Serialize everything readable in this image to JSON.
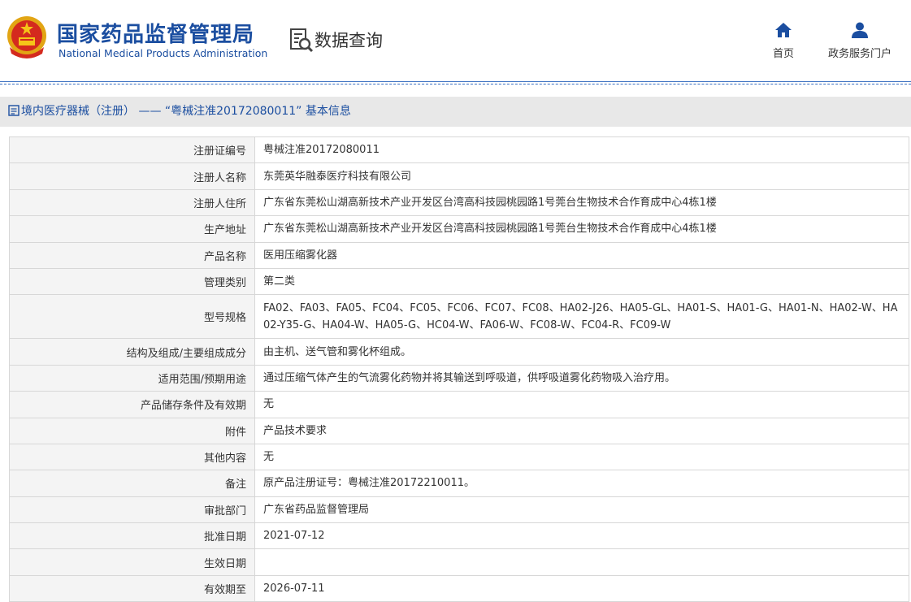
{
  "header": {
    "agency_name_cn": "国家药品监督管理局",
    "agency_name_en": "National Medical Products Administration",
    "section_title": "数据查询",
    "nav": [
      {
        "label": "首页",
        "icon": "home-icon"
      },
      {
        "label": "政务服务门户",
        "icon": "user-icon"
      }
    ]
  },
  "breadcrumb": {
    "text": "境内医疗器械（注册） —— “粤械注准20172080011” 基本信息"
  },
  "colors": {
    "brand_blue": "#1b4ea0",
    "label_bg": "#f4f4f4",
    "breadcrumb_bg": "#e8e8e8",
    "border": "#d7d7d7"
  },
  "record": {
    "rows": [
      {
        "label": "注册证编号",
        "value": "粤械注准20172080011"
      },
      {
        "label": "注册人名称",
        "value": "东莞英华融泰医疗科技有限公司"
      },
      {
        "label": "注册人住所",
        "value": "广东省东莞松山湖高新技术产业开发区台湾高科技园桃园路1号莞台生物技术合作育成中心4栋1楼"
      },
      {
        "label": "生产地址",
        "value": "广东省东莞松山湖高新技术产业开发区台湾高科技园桃园路1号莞台生物技术合作育成中心4栋1楼"
      },
      {
        "label": "产品名称",
        "value": "医用压缩雾化器"
      },
      {
        "label": "管理类别",
        "value": "第二类"
      },
      {
        "label": "型号规格",
        "value": "FA02、FA03、FA05、FC04、FC05、FC06、FC07、FC08、HA02-J26、HA05-GL、HA01-S、HA01-G、HA01-N、HA02-W、HA02-Y35-G、HA04-W、HA05-G、HC04-W、FA06-W、FC08-W、FC04-R、FC09-W"
      },
      {
        "label": "结构及组成/主要组成成分",
        "value": "由主机、送气管和雾化杯组成。"
      },
      {
        "label": "适用范围/预期用途",
        "value": "通过压缩气体产生的气流雾化药物并将其输送到呼吸道，供呼吸道雾化药物吸入治疗用。"
      },
      {
        "label": "产品储存条件及有效期",
        "value": "无"
      },
      {
        "label": "附件",
        "value": "产品技术要求"
      },
      {
        "label": "其他内容",
        "value": "无"
      },
      {
        "label": "备注",
        "value": "原产品注册证号：粤械注准20172210011。"
      },
      {
        "label": "审批部门",
        "value": "广东省药品监督管理局"
      },
      {
        "label": "批准日期",
        "value": "2021-07-12"
      },
      {
        "label": "生效日期",
        "value": ""
      },
      {
        "label": "有效期至",
        "value": "2026-07-11"
      }
    ]
  }
}
